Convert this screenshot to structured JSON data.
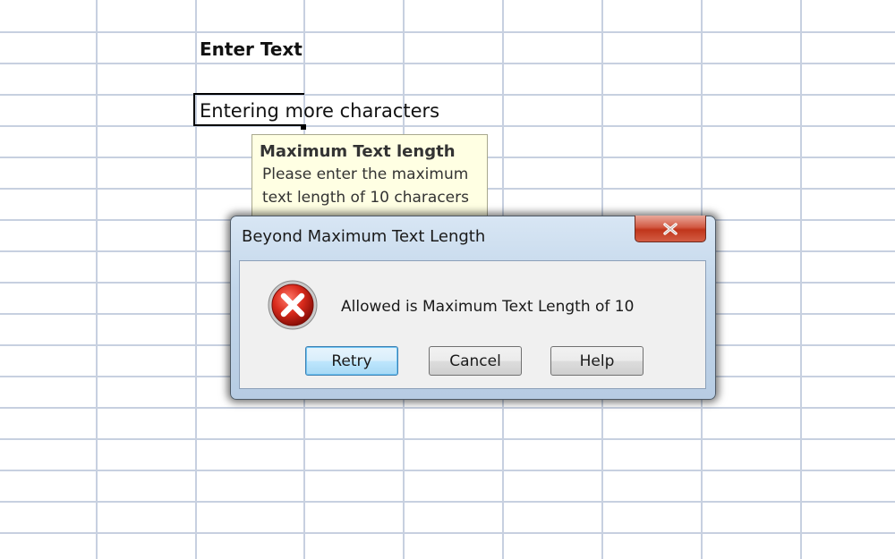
{
  "sheet": {
    "header_cell_text": "Enter Text",
    "active_cell_text": "Entering more characters"
  },
  "input_message": {
    "title": "Maximum Text length",
    "body": "Please enter the maximum text length of 10 characers"
  },
  "dialog": {
    "title": "Beyond Maximum Text Length",
    "close_icon": "close-icon",
    "icon": "error-icon",
    "message": "Allowed is Maximum Text Length of 10",
    "buttons": {
      "retry": "Retry",
      "cancel": "Cancel",
      "help": "Help"
    }
  },
  "colors": {
    "gridline": "#c7d0e0",
    "tooltip_bg": "#ffffe3",
    "dialog_frame": "#c2d6ea",
    "close_button": "#c0351b",
    "error_red": "#d42020"
  }
}
